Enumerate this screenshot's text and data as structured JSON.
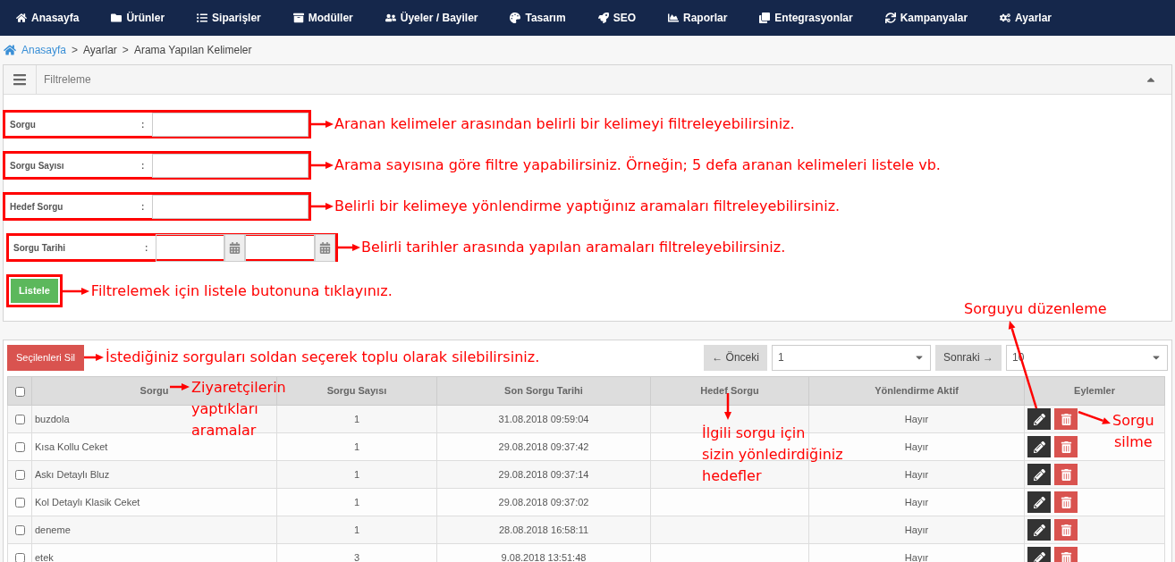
{
  "nav": [
    {
      "label": "Anasayfa"
    },
    {
      "label": "Ürünler"
    },
    {
      "label": "Siparişler"
    },
    {
      "label": "Modüller"
    },
    {
      "label": "Üyeler / Bayiler"
    },
    {
      "label": "Tasarım"
    },
    {
      "label": "SEO"
    },
    {
      "label": "Raporlar"
    },
    {
      "label": "Entegrasyonlar"
    },
    {
      "label": "Kampanyalar"
    },
    {
      "label": "Ayarlar"
    }
  ],
  "breadcrumb": {
    "separator": ">",
    "items": [
      {
        "label": "Anasayfa",
        "link": true
      },
      {
        "label": "Ayarlar",
        "link": false
      },
      {
        "label": "Arama Yapılan Kelimeler",
        "link": false
      }
    ]
  },
  "filter": {
    "title": "Filtreleme",
    "expanded": true,
    "colon": ":",
    "fields": [
      {
        "label": "Sorgu",
        "kind": "text",
        "note": "Aranan kelimeler arasından belirli bir kelimeyi filtreleyebilirsiniz."
      },
      {
        "label": "Sorgu Sayısı",
        "kind": "text",
        "note": "Arama sayısına göre filtre yapabilirsiniz. Örneğin; 5 defa aranan kelimeleri listele vb."
      },
      {
        "label": "Hedef Sorgu",
        "kind": "text",
        "note": "Belirli bir kelimeye yönlendirme yaptığınız aramaları filtreleyebilirsiniz."
      },
      {
        "label": "Sorgu Tarihi",
        "kind": "daterange",
        "note": "Belirli tarihler arasında yapılan aramaları filtreleyebilirsiniz."
      }
    ],
    "submit": {
      "label": "Listele",
      "note": "Filtrelemek için listele butonuna tıklayınız."
    }
  },
  "table_panel": {
    "delete_selected": {
      "label": "Seçilenleri Sil",
      "note": "İstediğiniz sorguları soldan seçerek toplu olarak silebilirsiniz."
    },
    "pagination": {
      "prev": "← Önceki",
      "page": "1",
      "next": "Sonraki →",
      "page_size": "10"
    },
    "select_all_checked": false,
    "columns": [
      "Sorgu",
      "Sorgu Sayısı",
      "Son Sorgu Tarihi",
      "Hedef Sorgu",
      "Yönlendirme Aktif",
      "Eylemler"
    ],
    "rows": [
      {
        "checked": false,
        "query": "buzdola",
        "count": "1",
        "last_date": "31.08.2018 09:59:04",
        "redirect_active": "Hayır"
      },
      {
        "checked": false,
        "query": "Kısa Kollu Ceket",
        "count": "1",
        "last_date": "29.08.2018 09:37:42",
        "redirect_active": "Hayır"
      },
      {
        "checked": false,
        "query": "Askı Detaylı Bluz",
        "count": "1",
        "last_date": "29.08.2018 09:37:14",
        "redirect_active": "Hayır"
      },
      {
        "checked": false,
        "query": "Kol Detaylı Klasik Ceket",
        "count": "1",
        "last_date": "29.08.2018 09:37:02",
        "redirect_active": "Hayır"
      },
      {
        "checked": false,
        "query": "deneme",
        "count": "1",
        "last_date": "28.08.2018 16:58:11",
        "redirect_active": "Hayır"
      },
      {
        "checked": false,
        "query": "etek",
        "count": "3",
        "last_date": "9.08.2018 13:51:48",
        "redirect_active": "Hayır"
      }
    ],
    "notes": {
      "query_column": "Ziyaretçilerin\nyaptıkları\naramalar",
      "target_column": "İlgili sorgu için\nsizin yönledirdiğiniz\nhedefler",
      "edit": "Sorguyu düzenleme",
      "delete": "Sorgu\nsilme"
    }
  }
}
